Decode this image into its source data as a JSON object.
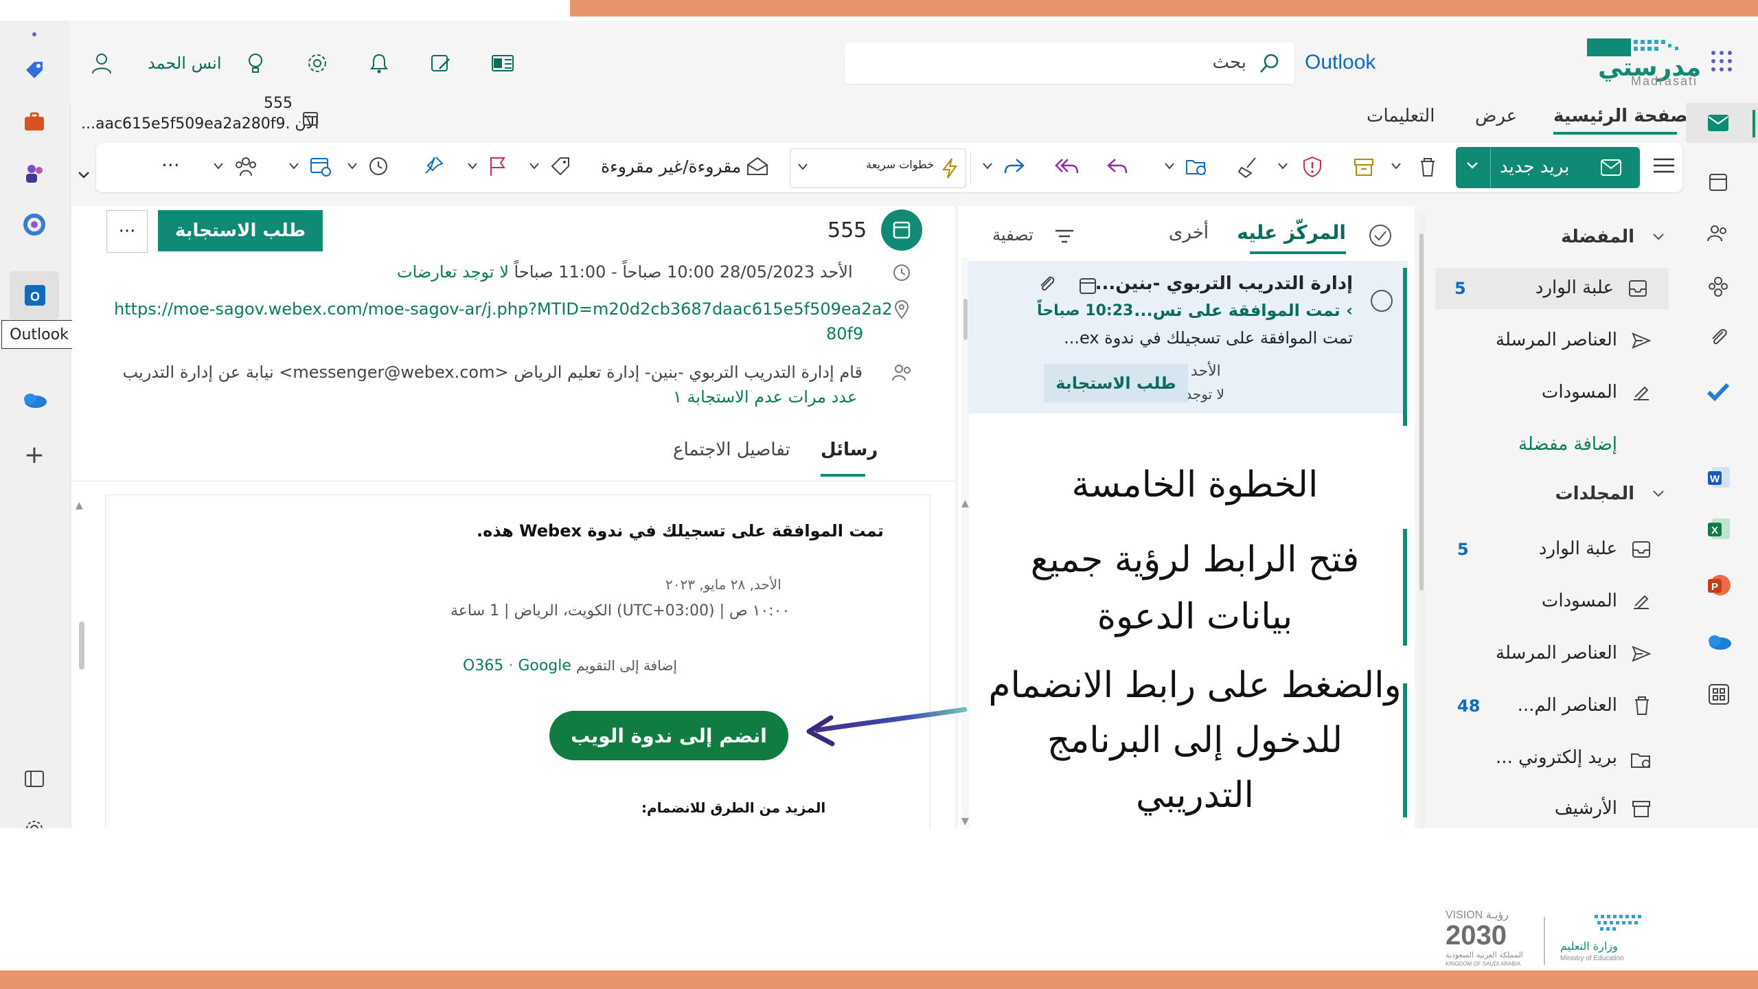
{
  "app": {
    "name": "Outlook",
    "brand_name": "مدرستي",
    "brand_latin": "Madrasati"
  },
  "header": {
    "search_placeholder": "بحث",
    "user_name": "انس الحمد",
    "tabs": [
      "الصفحة الرئيسية",
      "عرض",
      "التعليمات"
    ],
    "tab_active": "الصفحة الرئيسية",
    "breadcrumb_title": "555",
    "breadcrumb_sub": "الآن .aac615e5f509ea2a280f9..."
  },
  "ribbon": {
    "new_mail": "بريد جديد",
    "quick_steps": "خطوات سريعة",
    "read_unread": "مقروءة/غير مقروءة",
    "more": "···"
  },
  "folders": {
    "favorites_header": "المفضلة",
    "favorites": [
      {
        "label": "علبة الوارد",
        "count": "5",
        "icon": "inbox-icon"
      },
      {
        "label": "العناصر المرسلة",
        "count": "",
        "icon": "send-icon"
      },
      {
        "label": "المسودات",
        "count": "",
        "icon": "draft-icon"
      }
    ],
    "add_favorite": "إضافة مفضلة",
    "folders_header": "المجلدات",
    "folders": [
      {
        "label": "علبة الوارد",
        "count": "5",
        "icon": "inbox-icon"
      },
      {
        "label": "المسودات",
        "count": "",
        "icon": "draft-icon"
      },
      {
        "label": "العناصر المرسلة",
        "count": "",
        "icon": "send-icon"
      },
      {
        "label": "العناصر الم...",
        "count": "48",
        "icon": "trash-icon"
      },
      {
        "label": "بريد إلكتروني ...",
        "count": "",
        "icon": "junk-icon"
      },
      {
        "label": "الأرشيف",
        "count": "",
        "icon": "archive-icon"
      }
    ]
  },
  "message_list": {
    "tab_focused": "المركّز عليه",
    "tab_other": "أخرى",
    "filter": "تصفية",
    "item": {
      "sender": "إدارة التدريب التربوي -بنين...",
      "subject": "تمت الموافقة على تس...",
      "time": "10:23 صباحاً",
      "preview": "تمت الموافقة على تسجيلك في ندوة ex...",
      "meeting_date": "الأحد 2023...",
      "meeting_conflict": "لا توجد تعار...",
      "rsvp_button": "طلب الاستجابة"
    }
  },
  "reading_pane": {
    "title": "555",
    "rsvp_button": "طلب الاستجابة",
    "more_button": "···",
    "datetime": "الأحد 28/05/2023 10:00 صباحاً - 11:00 صباحاً",
    "no_conflicts": "لا توجد تعارضات",
    "location_link_1": "https://moe-sagov.webex.com/moe-sagov-ar/j.php?MTID=m20d2cb3687daac615e5f509ea2a2",
    "location_link_2": "80f9",
    "organizer_line": "قام إدارة التدريب التربوي -بنين- إدارة تعليم الرياض <messenger@webex.com> نيابة عن إدارة التدريب",
    "no_response_count": "عدد مرات عدم الاستجابة ١",
    "tabs": [
      "رسائل",
      "تفاصيل الاجتماع"
    ],
    "tab_active": "رسائل"
  },
  "email_body": {
    "heading": "تمت الموافقة على تسجيلك في ندوة Webex هذه.",
    "date": "الأحد, ٢٨ مايو, ٢٠٢٣",
    "time_line": "١٠:٠٠ ص | (UTC+03:00) الكويت، الرياض | 1 ساعة",
    "add_to_calendar": "إضافة إلى التقويم",
    "o365": "O365",
    "google": "Google",
    "join_button": "انضم إلى ندوة الويب",
    "more_ways": "المزيد من الطرق للانضمام:"
  },
  "annotation": {
    "step_title": "الخطوة الخامسة",
    "line1": "فتح الرابط لرؤية جميع",
    "line2": "بيانات الدعوة",
    "line3": "والضغط على رابط الانضمام",
    "line4": "للدخول إلى البرنامج",
    "line5": "التدريبي"
  },
  "left_rail": {
    "tooltip": "Outlook"
  },
  "footer": {
    "vision_label": "VISION رؤيـة",
    "vision_year": "2030",
    "vision_sub": "المملكة العربية السعودية",
    "vision_sub_en": "KINGDOM OF SAUDI ARABIA",
    "ministry_ar": "وزارة التعليم",
    "ministry_en": "Ministry of Education"
  },
  "colors": {
    "accent": "#0f8a74",
    "outlook_blue": "#0f6cbd",
    "slide_orange": "#e8946b",
    "join_green": "#107c41"
  }
}
